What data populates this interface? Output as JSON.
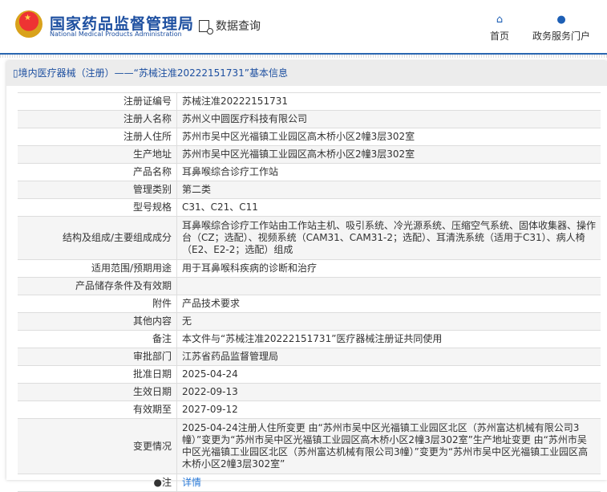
{
  "header": {
    "brand_cn": "国家药品监督管理局",
    "brand_en": "National Medical Products Administration",
    "query_label": "数据查询",
    "nav": [
      {
        "label": "首页",
        "icon": "home-icon"
      },
      {
        "label": "政务服务门户",
        "icon": "user-icon"
      }
    ]
  },
  "breadcrumb": "境内医疗器械（注册）——“苏械注准20222151731”基本信息",
  "rows": [
    {
      "label": "注册证编号",
      "value": "苏械注准20222151731"
    },
    {
      "label": "注册人名称",
      "value": "苏州义中圆医疗科技有限公司"
    },
    {
      "label": "注册人住所",
      "value": "苏州市吴中区光福镇工业园区高木桥小区2幢3层302室"
    },
    {
      "label": "生产地址",
      "value": "苏州市吴中区光福镇工业园区高木桥小区2幢3层302室"
    },
    {
      "label": "产品名称",
      "value": "耳鼻喉综合诊疗工作站"
    },
    {
      "label": "管理类别",
      "value": "第二类"
    },
    {
      "label": "型号规格",
      "value": "C31、C21、C11"
    },
    {
      "label": "结构及组成/主要组成成分",
      "value": "耳鼻喉综合诊疗工作站由工作站主机、吸引系统、冷光源系统、压缩空气系统、固体收集器、操作台（CZ；选配）、视频系统（CAM31、CAM31-2；选配）、耳清洗系统（适用于C31）、病人椅（E2、E2-2；选配）组成"
    },
    {
      "label": "适用范围/预期用途",
      "value": "用于耳鼻喉科疾病的诊断和治疗"
    },
    {
      "label": "产品储存条件及有效期",
      "value": ""
    },
    {
      "label": "附件",
      "value": "产品技术要求"
    },
    {
      "label": "其他内容",
      "value": "无"
    },
    {
      "label": "备注",
      "value": "本文件与“苏械注准20222151731”医疗器械注册证共同使用"
    },
    {
      "label": "审批部门",
      "value": "江苏省药品监督管理局"
    },
    {
      "label": "批准日期",
      "value": "2025-04-24"
    },
    {
      "label": "生效日期",
      "value": "2022-09-13"
    },
    {
      "label": "有效期至",
      "value": "2027-09-12"
    },
    {
      "label": "变更情况",
      "value": "2025-04-24注册人住所变更 由“苏州市吴中区光福镇工业园区北区（苏州富达机械有限公司3幢）”变更为“苏州市吴中区光福镇工业园区高木桥小区2幢3层302室”生产地址变更 由“苏州市吴中区光福镇工业园区北区（苏州富达机械有限公司3幢）”变更为“苏州市吴中区光福镇工业园区高木桥小区2幢3层302室”"
    }
  ],
  "note": {
    "label": "注",
    "link": "详情"
  }
}
